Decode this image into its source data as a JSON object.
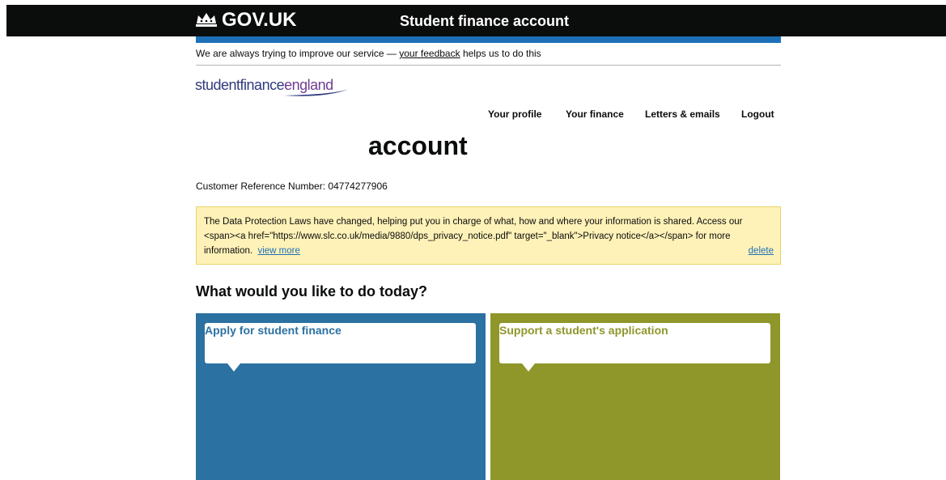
{
  "header": {
    "logo_text": "GOV.UK",
    "service_name": "Student finance account",
    "crown_icon": "crown-icon",
    "background_color": "#0b0c0c",
    "accent_bar_color": "#1d70b8"
  },
  "feedback_banner": {
    "prefix": "We are always trying to improve our service —",
    "link": "your feedback",
    "suffix": "helps us to do this"
  },
  "brand": {
    "part1": "studentfinance",
    "part2": "england"
  },
  "nav": {
    "items": [
      "Your profile",
      "Your finance",
      "Letters & emails",
      "Logout"
    ]
  },
  "page": {
    "title": "account",
    "crn_label": "Customer Reference Number:",
    "crn_value": "04774277906"
  },
  "notice": {
    "text": "The Data Protection Laws have changed, helping put you in charge of what, how and where your information is shared. Access our <span><a href=\"https://www.slc.co.uk/media/9880/dps_privacy_notice.pdf\" target=\"_blank\">Privacy notice</a></span> for more information.",
    "view_more": "view more",
    "delete": "delete",
    "background_color": "#fff2b8"
  },
  "tasks": {
    "heading": "What would you like to do today?",
    "cards": [
      {
        "label": "Apply for student finance",
        "color": "#2b71a2"
      },
      {
        "label": "Support a student's application",
        "color": "#8f962a"
      }
    ]
  }
}
